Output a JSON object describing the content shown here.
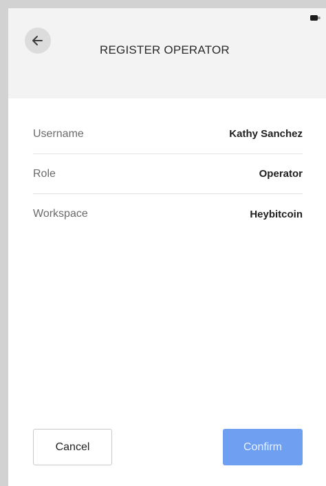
{
  "header": {
    "title": "REGISTER OPERATOR",
    "back_icon": "arrow-left-icon",
    "battery_icon": "battery-icon"
  },
  "details": [
    {
      "label": "Username",
      "value": "Kathy Sanchez"
    },
    {
      "label": "Role",
      "value": "Operator"
    },
    {
      "label": "Workspace",
      "value": "Heybitcoin"
    }
  ],
  "actions": {
    "cancel_label": "Cancel",
    "confirm_label": "Confirm"
  },
  "colors": {
    "header_bg": "#f3f3f3",
    "frame": "#d2d2d2",
    "confirm_bg": "#6e9ff0"
  }
}
